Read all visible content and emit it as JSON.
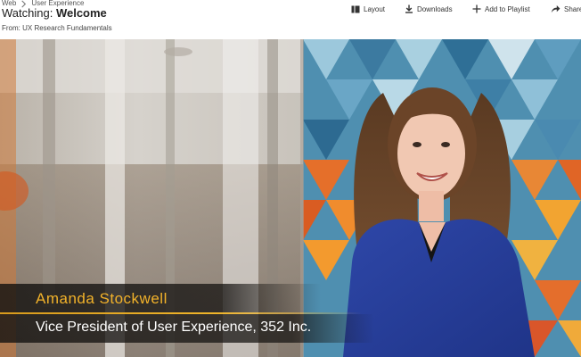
{
  "breadcrumb": {
    "items": [
      "Web",
      "User Experience"
    ]
  },
  "header": {
    "watching_label": "Watching:",
    "video_title": "Welcome",
    "from_text": "From: UX Research Fundamentals"
  },
  "toolbar": {
    "layout_label": "Layout",
    "downloads_label": "Downloads",
    "add_to_playlist_label": "Add to Playlist",
    "share_label": "Share"
  },
  "video": {
    "speaker_name": "Amanda Stockwell",
    "speaker_title": "Vice President of User Experience, 352 Inc.",
    "colors": {
      "name_text": "#f2b22a",
      "accent_line": "#e9ab24",
      "role_text": "#ffffff"
    }
  }
}
